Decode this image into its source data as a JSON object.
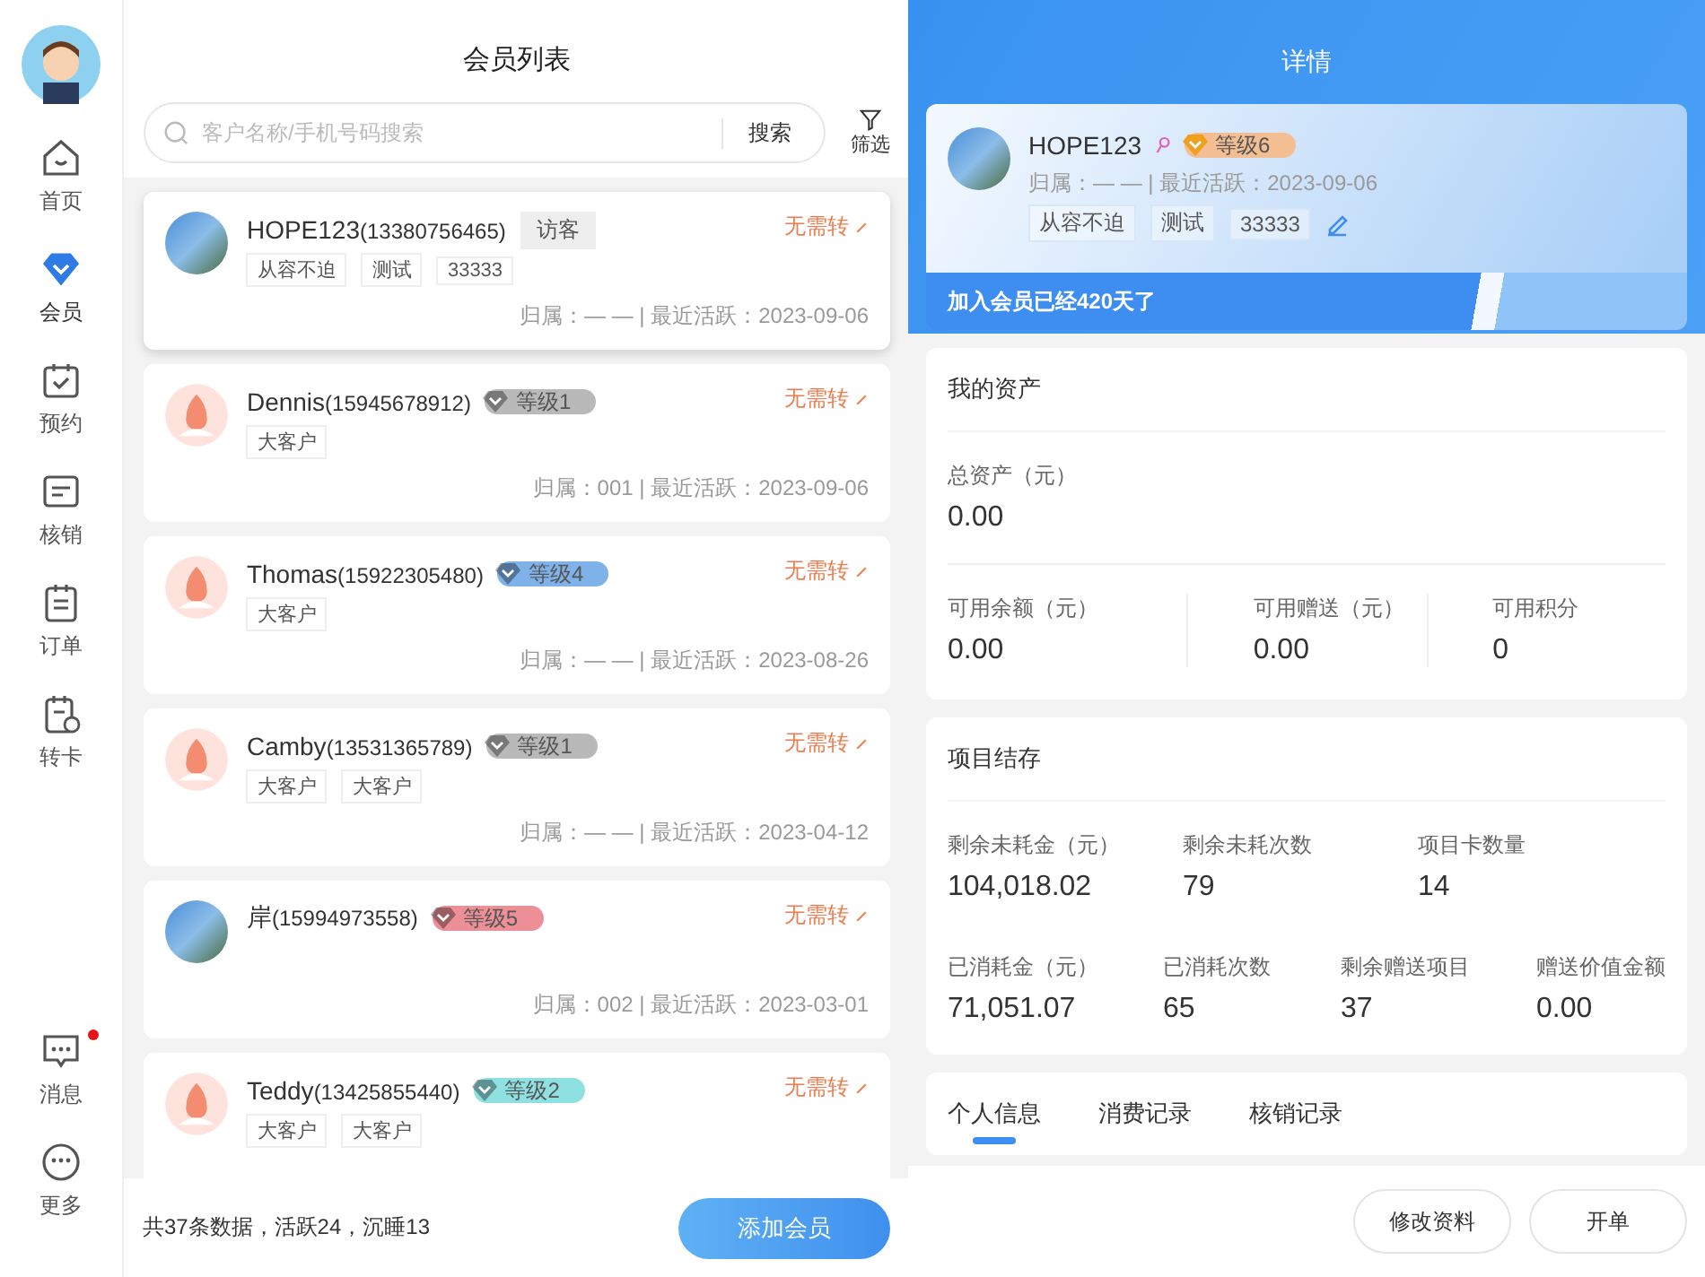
{
  "sidebar": {
    "items": [
      {
        "label": "首页",
        "selected": false
      },
      {
        "label": "会员",
        "selected": true
      },
      {
        "label": "预约",
        "selected": false
      },
      {
        "label": "核销",
        "selected": false
      },
      {
        "label": "订单",
        "selected": false
      },
      {
        "label": "转卡",
        "selected": false
      }
    ],
    "bottom_items": [
      {
        "label": "消息",
        "unread": true
      },
      {
        "label": "更多",
        "unread": false
      }
    ]
  },
  "member_list": {
    "title": "会员列表",
    "search": {
      "placeholder": "客户名称/手机号码搜索",
      "button": "搜索"
    },
    "filter": "筛选",
    "members": [
      {
        "name": "HOPE123",
        "phone": "(13380756465)",
        "photo": true,
        "badge": {
          "kind": "visitor",
          "text": "访客"
        },
        "tags": [
          "从容不迫",
          "测试",
          "33333"
        ],
        "transfer": "无需转",
        "owner": "归属：— — | 最近活跃：2023-09-06",
        "selected": true
      },
      {
        "name": "Dennis",
        "phone": "(15945678912)",
        "photo": false,
        "badge": {
          "kind": "level",
          "text": "等级1",
          "color": "#b9b9b9"
        },
        "tags": [
          "大客户"
        ],
        "transfer": "无需转",
        "owner": "归属：001 | 最近活跃：2023-09-06",
        "selected": false
      },
      {
        "name": "Thomas",
        "phone": "(15922305480)",
        "photo": false,
        "badge": {
          "kind": "level",
          "text": "等级4",
          "color": "#7fb2e8"
        },
        "tags": [
          "大客户"
        ],
        "transfer": "无需转",
        "owner": "归属：— — | 最近活跃：2023-08-26",
        "selected": false
      },
      {
        "name": "Camby",
        "phone": "(13531365789)",
        "photo": false,
        "badge": {
          "kind": "level",
          "text": "等级1",
          "color": "#b9b9b9"
        },
        "tags": [
          "大客户",
          "大客户"
        ],
        "transfer": "无需转",
        "owner": "归属：— — | 最近活跃：2023-04-12",
        "selected": false
      },
      {
        "name": "岸",
        "phone": "(15994973558)",
        "photo": true,
        "badge": {
          "kind": "level",
          "text": "等级5",
          "color": "#ec8f97"
        },
        "transfer": "无需转",
        "owner": "归属：002 | 最近活跃：2023-03-01",
        "selected": false
      },
      {
        "name": "Teddy",
        "phone": "(13425855440)",
        "photo": false,
        "badge": {
          "kind": "level",
          "text": "等级2",
          "color": "#8fe0e0"
        },
        "tags": [
          "大客户",
          "大客户"
        ],
        "transfer": "无需转",
        "selected": false
      }
    ],
    "summary": "共37条数据，活跃24，沉睡13",
    "add_button": "添加会员"
  },
  "detail": {
    "title": "详情",
    "name": "HOPE123",
    "badge": {
      "text": "等级6",
      "color": "#f2be92"
    },
    "meta": "归属：— — |  最近活跃：2023-09-06",
    "tags": [
      "从容不迫",
      "测试",
      "33333"
    ],
    "banner": "加入会员已经420天了",
    "assets": {
      "title": "我的资产",
      "total": {
        "label": "总资产（元）",
        "value": "0.00"
      },
      "items": [
        {
          "label": "可用余额（元）",
          "value": "0.00"
        },
        {
          "label": "可用赠送（元）",
          "value": "0.00"
        },
        {
          "label": "可用积分",
          "value": "0"
        }
      ]
    },
    "projects": {
      "title": "项目结存",
      "row_1": [
        {
          "label": "剩余未耗金（元）",
          "value": "104,018.02"
        },
        {
          "label": "剩余未耗次数",
          "value": "79"
        },
        {
          "label": "项目卡数量",
          "value": "14"
        }
      ],
      "row_2": [
        {
          "label": "已消耗金（元）",
          "value": "71,051.07"
        },
        {
          "label": "已消耗次数",
          "value": "65"
        },
        {
          "label": "剩余赠送项目",
          "value": "37"
        },
        {
          "label": "赠送价值金额",
          "value": "0.00"
        }
      ]
    },
    "tabs": [
      {
        "label": "个人信息",
        "selected": true
      },
      {
        "label": "消费记录",
        "selected": false
      },
      {
        "label": "核销记录",
        "selected": false
      }
    ],
    "buttons": [
      "修改资料",
      "开单"
    ]
  }
}
